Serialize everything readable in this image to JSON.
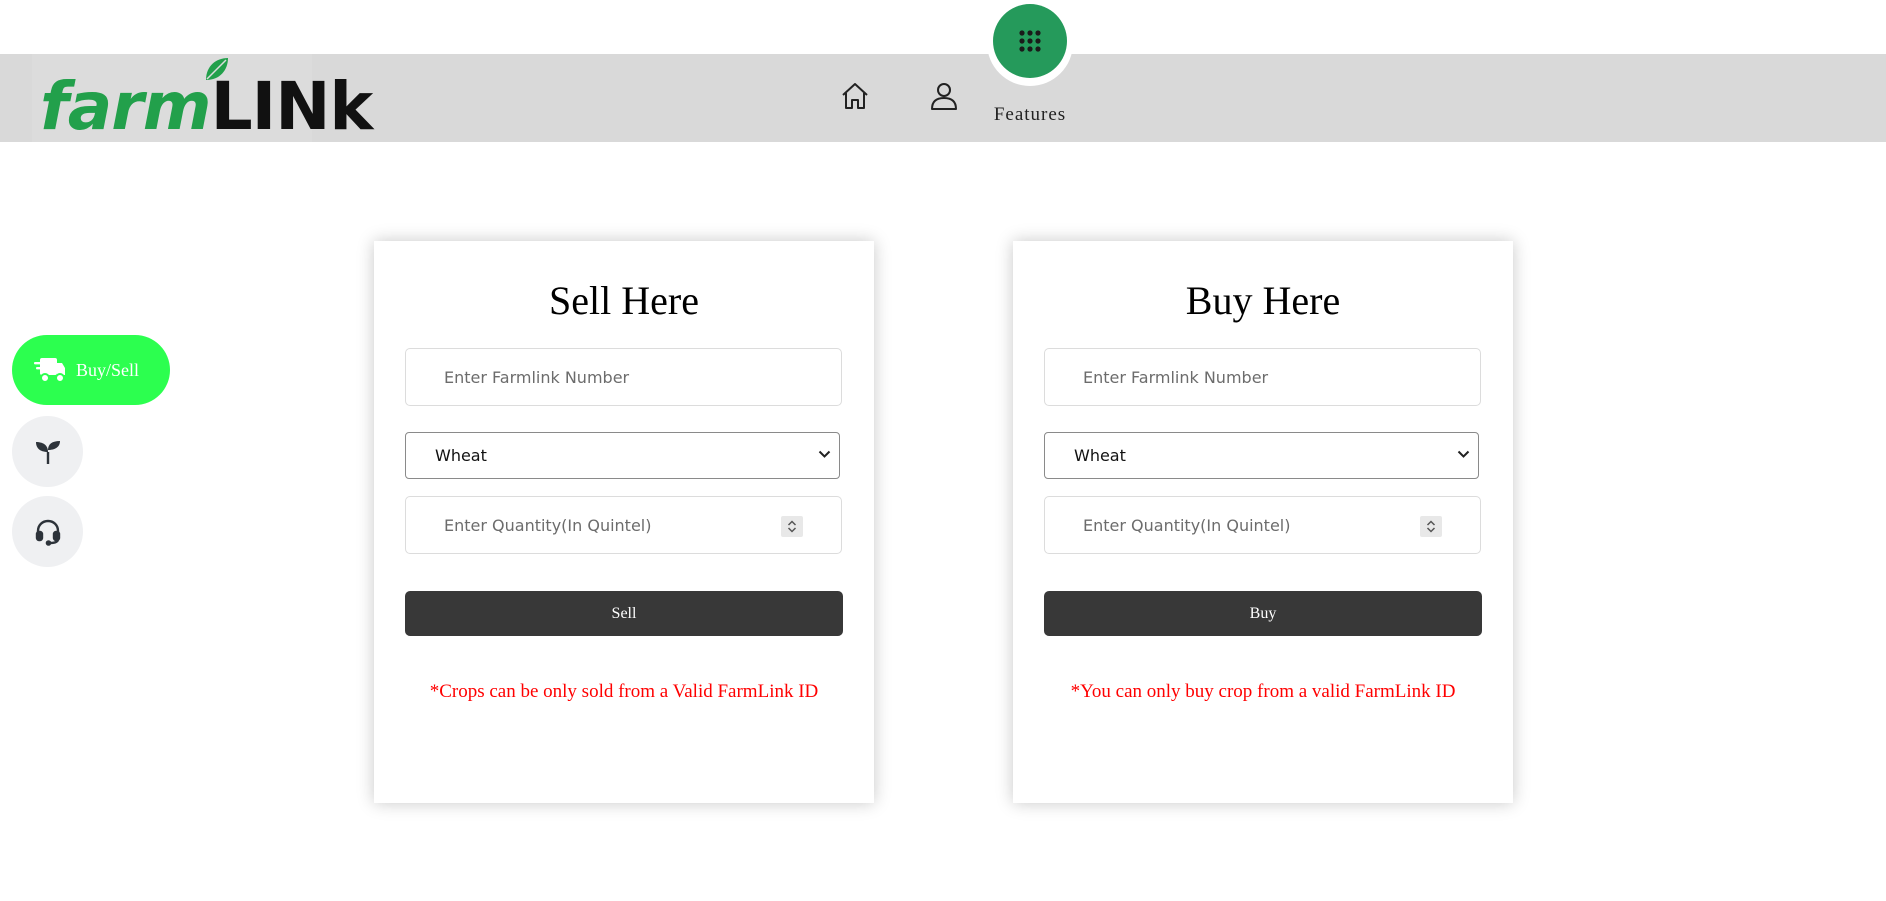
{
  "colors": {
    "header_bg": "#d9d9d9",
    "brand_green": "#22a04b",
    "features_green": "#259a5b",
    "active_menu_green": "#2cff4f",
    "button_dark": "#383838",
    "note_red": "#ff0000"
  },
  "header": {
    "logo": {
      "part1": "farm",
      "part2": "LINk",
      "leaf_icon": "leaf-icon"
    },
    "nav": [
      {
        "name": "home",
        "icon": "home-icon"
      },
      {
        "name": "profile",
        "icon": "user-icon"
      }
    ],
    "features": {
      "label": "Features",
      "icon": "grid-icon"
    }
  },
  "side_menu": [
    {
      "label": "Buy/Sell",
      "icon": "delivery-truck-icon",
      "active": true
    },
    {
      "label": "",
      "icon": "sprout-icon",
      "active": false
    },
    {
      "label": "",
      "icon": "headset-icon",
      "active": false
    }
  ],
  "sell_card": {
    "title": "Sell Here",
    "farmlink_placeholder": "Enter Farmlink Number",
    "crop_selected": "Wheat",
    "quantity_placeholder": "Enter Quantity(In Quintel)",
    "button_label": "Sell",
    "note": "*Crops can be only sold from a Valid FarmLink ID"
  },
  "buy_card": {
    "title": "Buy Here",
    "farmlink_placeholder": "Enter Farmlink Number",
    "crop_selected": "Wheat",
    "quantity_placeholder": "Enter Quantity(In Quintel)",
    "button_label": "Buy",
    "note": "*You can only buy crop from a valid FarmLink ID"
  }
}
